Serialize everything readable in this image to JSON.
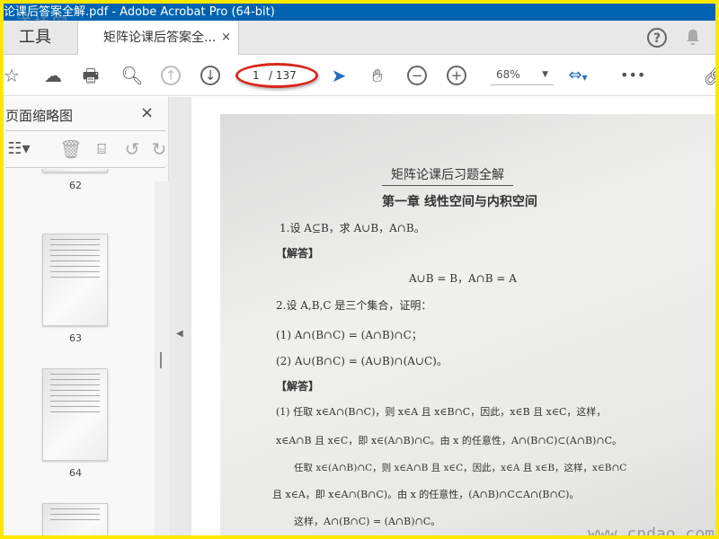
{
  "window": {
    "title": "论课后答案全解.pdf - Adobe Acrobat Pro (64-bit)",
    "logo": "道桥网"
  },
  "tabs": {
    "tools": "工具",
    "document": "矩阵论课后答案全...",
    "close": "×"
  },
  "header": {
    "help": "?",
    "notifications": "bell"
  },
  "toolbar": {
    "current_page": "1",
    "total_pages": "/ 137",
    "zoom": "68%"
  },
  "sidebar": {
    "title": "页面缩略图",
    "close": "×",
    "thumbnails": [
      {
        "label": "62"
      },
      {
        "label": "63"
      },
      {
        "label": "64"
      }
    ]
  },
  "document": {
    "title": "矩阵论课后习题全解",
    "chapter": "第一章  线性空间与内积空间",
    "lines": [
      "1.设 A⊆B，求 A∪B，A∩B。",
      "【解答】",
      "A∪B = B，A∩B = A",
      "2.设 A,B,C 是三个集合，证明：",
      "(1)  A∩(B∩C) = (A∩B)∩C；",
      "(2)  A∪(B∩C) = (A∪B)∩(A∪C)。",
      "【解答】",
      "(1) 任取 x∈A∩(B∩C)，则 x∈A 且 x∈B∩C，因此，x∈B 且 x∈C，这样，",
      "x∈A∩B 且 x∈C，即 x∈(A∩B)∩C。由 x 的任意性，A∩(B∩C)⊂(A∩B)∩C。",
      "任取 x∈(A∩B)∩C，则 x∈A∩B 且 x∈C，因此，x∈A 且 x∈B，这样，x∈B∩C",
      "且 x∈A，即 x∈A∩(B∩C)。由 x 的任意性，(A∩B)∩C⊂A∩(B∩C)。",
      "这样，A∩(B∩C) = (A∩B)∩C。"
    ],
    "watermark": "www.cndao.com"
  }
}
